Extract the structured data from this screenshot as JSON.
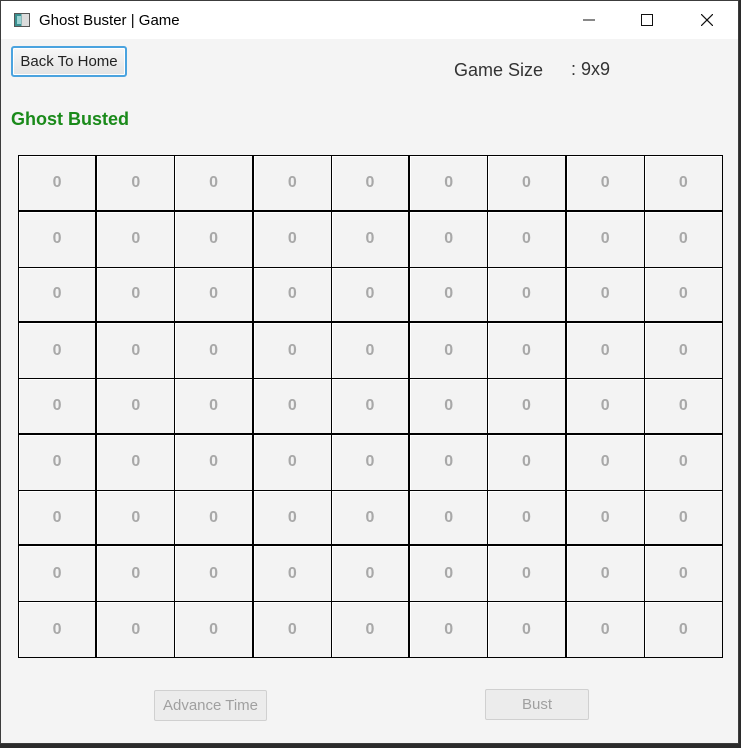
{
  "window": {
    "title": "Ghost Buster | Game",
    "controls": [
      "minimize-icon",
      "maximize-icon",
      "close-icon"
    ]
  },
  "header": {
    "back_label": "Back To Home",
    "game_size_label": "Game Size",
    "game_size_value": ": 9x9"
  },
  "status": {
    "text": "Ghost Busted",
    "color": "#1a8a1a"
  },
  "board": {
    "rows": 9,
    "cols": 9,
    "cells": [
      [
        "0",
        "0",
        "0",
        "0",
        "0",
        "0",
        "0",
        "0",
        "0"
      ],
      [
        "0",
        "0",
        "0",
        "0",
        "0",
        "0",
        "0",
        "0",
        "0"
      ],
      [
        "0",
        "0",
        "0",
        "0",
        "0",
        "0",
        "0",
        "0",
        "0"
      ],
      [
        "0",
        "0",
        "0",
        "0",
        "0",
        "0",
        "0",
        "0",
        "0"
      ],
      [
        "0",
        "0",
        "0",
        "0",
        "0",
        "0",
        "0",
        "0",
        "0"
      ],
      [
        "0",
        "0",
        "0",
        "0",
        "0",
        "0",
        "0",
        "0",
        "0"
      ],
      [
        "0",
        "0",
        "0",
        "0",
        "0",
        "0",
        "0",
        "0",
        "0"
      ],
      [
        "0",
        "0",
        "0",
        "0",
        "0",
        "0",
        "0",
        "0",
        "0"
      ],
      [
        "0",
        "0",
        "0",
        "0",
        "0",
        "0",
        "0",
        "0",
        "0"
      ]
    ]
  },
  "footer": {
    "advance_label": "Advance Time",
    "bust_label": "Bust",
    "disabled_text_color": "#a0a0a0"
  }
}
